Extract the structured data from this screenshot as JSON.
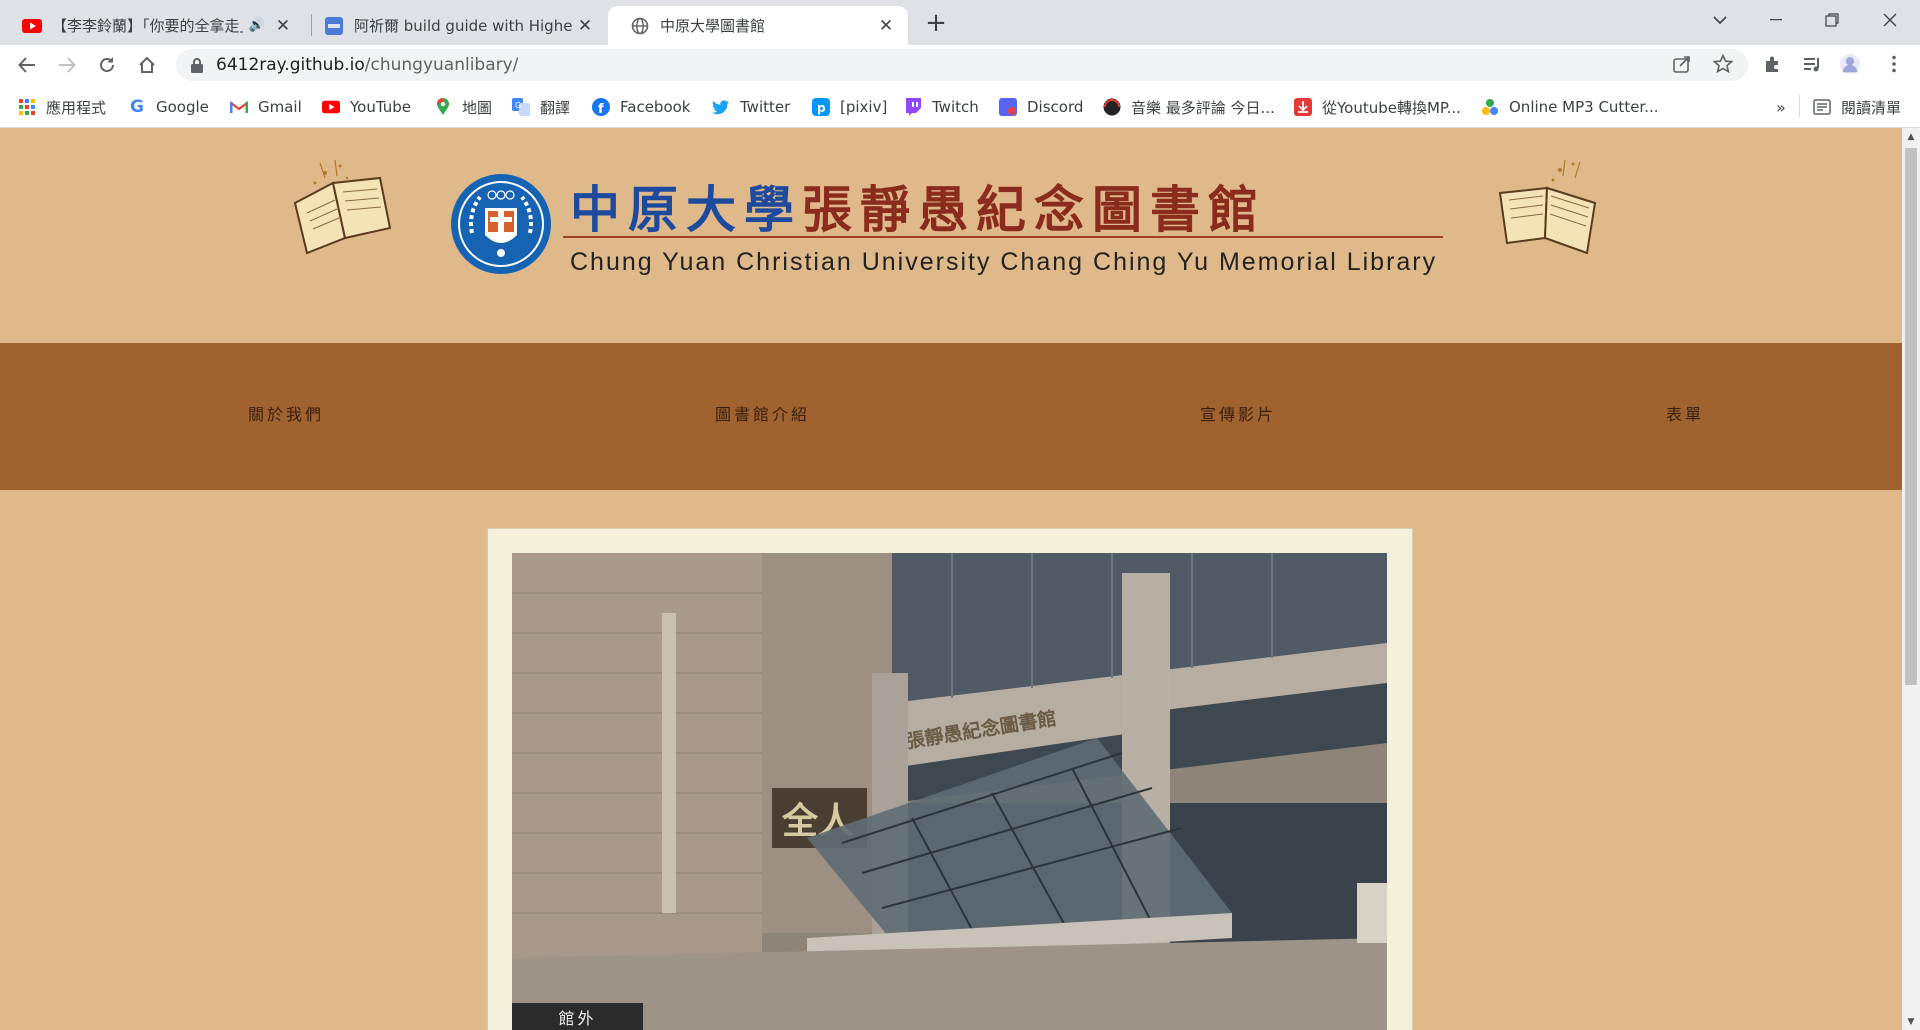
{
  "browser": {
    "tabs": [
      {
        "title": "【李李鈴蘭】「你要的全拿走」",
        "favicon": "youtube-icon",
        "audio": true
      },
      {
        "title": "阿祈爾 build guide with Highest",
        "favicon": "site-icon"
      },
      {
        "title": "中原大學圖書館",
        "favicon": "globe-icon",
        "active": true
      }
    ],
    "address": {
      "host": "6412ray.github.io",
      "path": "/chungyuanlibary/"
    },
    "bookmarks": [
      {
        "label": "應用程式",
        "icon": "apps-icon"
      },
      {
        "label": "Google",
        "icon": "google-icon"
      },
      {
        "label": "Gmail",
        "icon": "gmail-icon"
      },
      {
        "label": "YouTube",
        "icon": "youtube-icon"
      },
      {
        "label": "地圖",
        "icon": "maps-icon"
      },
      {
        "label": "翻譯",
        "icon": "translate-icon"
      },
      {
        "label": "Facebook",
        "icon": "facebook-icon"
      },
      {
        "label": "Twitter",
        "icon": "twitter-icon"
      },
      {
        "label": "[pixiv]",
        "icon": "pixiv-icon"
      },
      {
        "label": "Twitch",
        "icon": "twitch-icon"
      },
      {
        "label": "Discord",
        "icon": "discord-icon"
      },
      {
        "label": "音樂 最多評論 今日...",
        "icon": "music-icon"
      },
      {
        "label": "從Youtube轉換MP...",
        "icon": "download-icon"
      },
      {
        "label": "Online MP3 Cutter...",
        "icon": "cutter-icon"
      }
    ],
    "reading_list": "閱讀清單",
    "more": "»"
  },
  "page": {
    "title_cn_blue": "中原大學",
    "title_cn_red": "張靜愚紀念圖書館",
    "title_en": "Chung Yuan Christian University Chang Ching Yu Memorial Library",
    "nav": [
      "關於我們",
      "圖書館介紹",
      "宣傳影片",
      "表單"
    ],
    "photo_caption": "館外",
    "photo_sign_1": "全人",
    "photo_sign_2": "張靜愚紀念圖書館"
  },
  "colors": {
    "page_bg": "#dfb98a",
    "nav_bg": "#a0622f",
    "card_bg": "#f3f1dc",
    "title_blue": "#1e4a9e",
    "title_red": "#8a2b1e"
  }
}
